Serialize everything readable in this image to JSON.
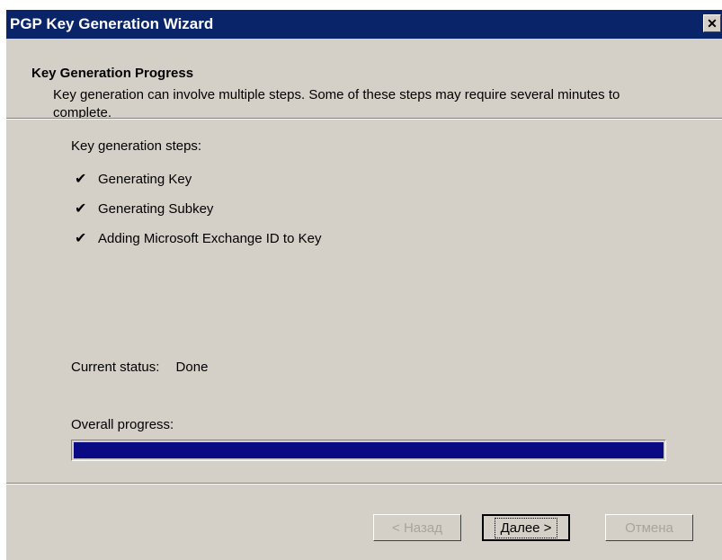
{
  "window": {
    "title": "PGP Key Generation Wizard",
    "close_symbol": "✕"
  },
  "header": {
    "title": "Key Generation Progress",
    "description": "Key generation can involve multiple steps.  Some of these steps may require several minutes to complete."
  },
  "steps_label": "Key generation steps:",
  "steps": [
    {
      "label": "Generating Key",
      "done": true
    },
    {
      "label": "Generating Subkey",
      "done": true
    },
    {
      "label": "Adding Microsoft Exchange ID to Key",
      "done": true
    }
  ],
  "check_symbol": "✔",
  "status": {
    "label": "Current status:",
    "value": "Done"
  },
  "progress": {
    "label": "Overall progress:",
    "fraction": 1.0
  },
  "buttons": {
    "back": "< Назад",
    "next": "Далее >",
    "cancel": "Отмена"
  },
  "colors": {
    "titlebar": "#0a246a",
    "progress_fill": "#0a0a84",
    "face": "#d4d0c8"
  }
}
